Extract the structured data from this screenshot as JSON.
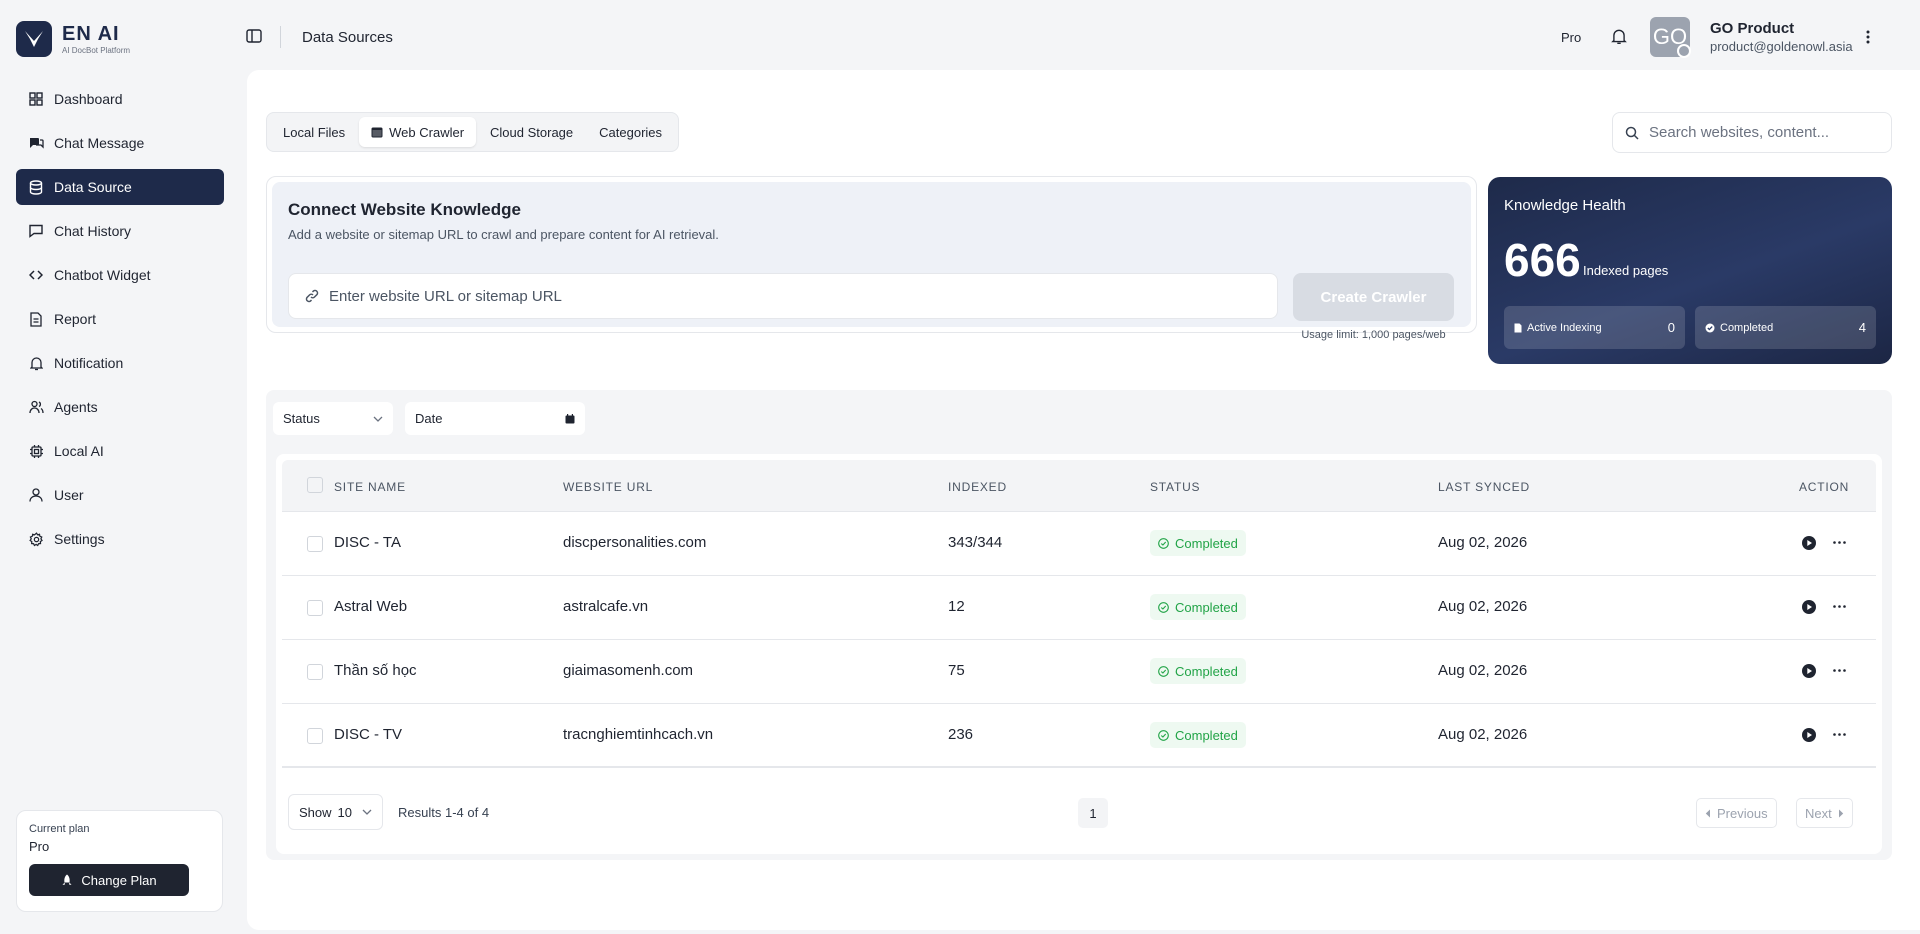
{
  "app": {
    "brand": "EN AI",
    "brand_sub": "AI DocBot Platform"
  },
  "sidebar": {
    "items": [
      {
        "label": "Dashboard",
        "icon": "grid-icon"
      },
      {
        "label": "Chat Message",
        "icon": "chat-bubbles-icon"
      },
      {
        "label": "Data Source",
        "icon": "database-icon",
        "active": true
      },
      {
        "label": "Chat History",
        "icon": "message-square-icon"
      },
      {
        "label": "Chatbot Widget",
        "icon": "code-icon"
      },
      {
        "label": "Report",
        "icon": "file-report-icon"
      },
      {
        "label": "Notification",
        "icon": "bell-icon"
      },
      {
        "label": "Agents",
        "icon": "agents-icon"
      },
      {
        "label": "Local AI",
        "icon": "chip-icon"
      },
      {
        "label": "User",
        "icon": "user-icon"
      },
      {
        "label": "Settings",
        "icon": "gear-icon"
      }
    ],
    "plan": {
      "label": "Current plan",
      "value": "Pro",
      "button": "Change Plan"
    }
  },
  "header": {
    "title": "Data Sources",
    "plan_badge": "Pro",
    "avatar_initials": "GO",
    "user_name": "GO Product",
    "user_email": "product@goldenowl.asia"
  },
  "tabs": [
    {
      "label": "Local Files"
    },
    {
      "label": "Web Crawler",
      "active": true
    },
    {
      "label": "Cloud Storage"
    },
    {
      "label": "Categories"
    }
  ],
  "search": {
    "placeholder": "Search websites, content..."
  },
  "connect": {
    "title": "Connect Website Knowledge",
    "description": "Add a website or sitemap URL to crawl and prepare content for AI retrieval.",
    "url_placeholder": "Enter website URL or sitemap URL",
    "button": "Create Crawler",
    "usage": "Usage limit: 1,000 pages/web"
  },
  "health": {
    "title": "Knowledge Health",
    "indexed_count": "666",
    "indexed_label": "Indexed pages",
    "active_label": "Active Indexing",
    "active_value": "0",
    "completed_label": "Completed",
    "completed_value": "4"
  },
  "filters": {
    "status": "Status",
    "date": "Date"
  },
  "table": {
    "columns": [
      "SITE NAME",
      "WEBSITE URL",
      "INDEXED",
      "STATUS",
      "LAST SYNCED",
      "ACTION"
    ],
    "rows": [
      {
        "name": "DISC - TA",
        "url": "discpersonalities.com",
        "indexed": "343/344",
        "status": "Completed",
        "synced": "Aug 02, 2026"
      },
      {
        "name": "Astral Web",
        "url": "astralcafe.vn",
        "indexed": "12",
        "status": "Completed",
        "synced": "Aug 02, 2026"
      },
      {
        "name": "Thần số học",
        "url": "giaimasomenh.com",
        "indexed": "75",
        "status": "Completed",
        "synced": "Aug 02, 2026"
      },
      {
        "name": "DISC - TV",
        "url": "tracnghiemtinhcach.vn",
        "indexed": "236",
        "status": "Completed",
        "synced": "Aug 02, 2026"
      }
    ]
  },
  "pagination": {
    "show_label": "Show",
    "show_value": "10",
    "results": "Results 1-4 of 4",
    "current_page": "1",
    "prev": "Previous",
    "next": "Next"
  },
  "colors": {
    "primary": "#1e2a4a",
    "success": "#22a447",
    "background": "#f4f5f7"
  }
}
